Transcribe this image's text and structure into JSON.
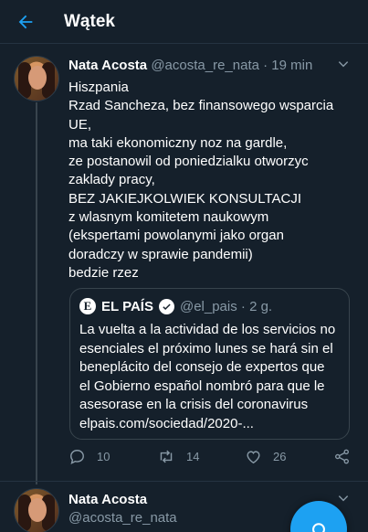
{
  "header": {
    "title": "Wątek",
    "back_icon": "arrow-left-icon"
  },
  "tweet": {
    "author_name": "Nata Acosta",
    "author_handle": "@acosta_re_nata",
    "time": "19 min",
    "lines": [
      "Hiszpania",
      "Rzad Sancheza, bez finansowego wsparcia",
      "UE,",
      "ma taki ekonomiczny noz na gardle,",
      "ze postanowil od poniedzialku otworzyc",
      "zaklady pracy,",
      "BEZ JAKIEJKOLWIEK KONSULTACJI",
      "z wlasnym komitetem naukowym",
      "(ekspertami powolanymi jako organ",
      "doradczy w sprawie pandemii)",
      "bedzie rzez"
    ],
    "quote": {
      "logo_letter": "E",
      "name": "EL PAÍS",
      "handle": "@el_pais",
      "time": "2 g.",
      "lines": [
        "La vuelta a la actividad de los servicios no",
        "esenciales el próximo lunes se hará sin el",
        "beneplácito del consejo de expertos que",
        "el Gobierno español nombró para que le",
        "asesorase en la crisis del coronavirus",
        "elpais.com/sociedad/2020-..."
      ]
    },
    "actions": {
      "replies": "10",
      "retweets": "14",
      "likes": "26"
    }
  },
  "next_tweet": {
    "author_name": "Nata Acosta",
    "author_handle": "@acosta_re_nata"
  },
  "colors": {
    "background": "#15202b",
    "accent": "#1da1f2",
    "muted": "#8899a6",
    "border": "#38444d"
  }
}
